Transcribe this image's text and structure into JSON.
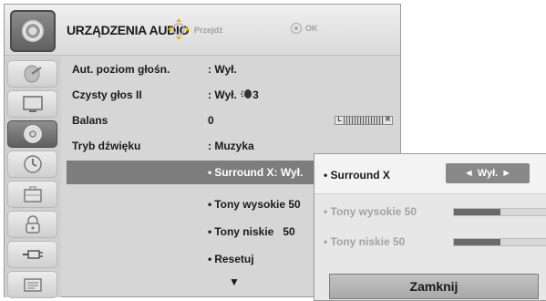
{
  "header": {
    "title": "URZĄDZENIA AUDIO",
    "nav_hint": "Przejdź",
    "ok_hint": "OK",
    "icon": "audio-speaker-icon"
  },
  "sidebar": {
    "items": [
      {
        "icon": "satellite-dish-icon",
        "active": false
      },
      {
        "icon": "tv-screen-icon",
        "active": false
      },
      {
        "icon": "audio-speaker-icon",
        "active": true
      },
      {
        "icon": "clock-icon",
        "active": false
      },
      {
        "icon": "option-briefcase-icon",
        "active": false
      },
      {
        "icon": "lock-icon",
        "active": false
      },
      {
        "icon": "input-plug-icon",
        "active": false
      },
      {
        "icon": "usb-media-icon",
        "active": false
      }
    ]
  },
  "menu": {
    "rows": [
      {
        "label": "Aut. poziom głośn.",
        "value": ": Wył."
      },
      {
        "label": "Czysty głos II",
        "value": ": Wył. ",
        "value_suffix": "3"
      },
      {
        "label": "Balans",
        "value": "0",
        "balance_left": "L",
        "balance_right": "R"
      },
      {
        "label": "Tryb dźwięku",
        "value": ": Muzyka"
      }
    ],
    "sub_items": [
      {
        "dot": "•",
        "label": "Surround X: Wył."
      },
      {
        "dot": "•",
        "label": "Tony wysokie",
        "value": "50"
      },
      {
        "dot": "•",
        "label": "Tony niskie",
        "value": "50"
      },
      {
        "dot": "•",
        "label": "Resetuj"
      }
    ],
    "more_arrow": "▼"
  },
  "popup": {
    "surround": {
      "dot": "•",
      "label": "Surround X",
      "left_arrow": "◄",
      "value": "Wył.",
      "right_arrow": "►"
    },
    "treble": {
      "dot": "•",
      "label": "Tony wysokie 50",
      "level": 0.5
    },
    "bass": {
      "dot": "•",
      "label": "Tony niskie 50",
      "level": 0.5
    },
    "close_label": "Zamknij"
  }
}
